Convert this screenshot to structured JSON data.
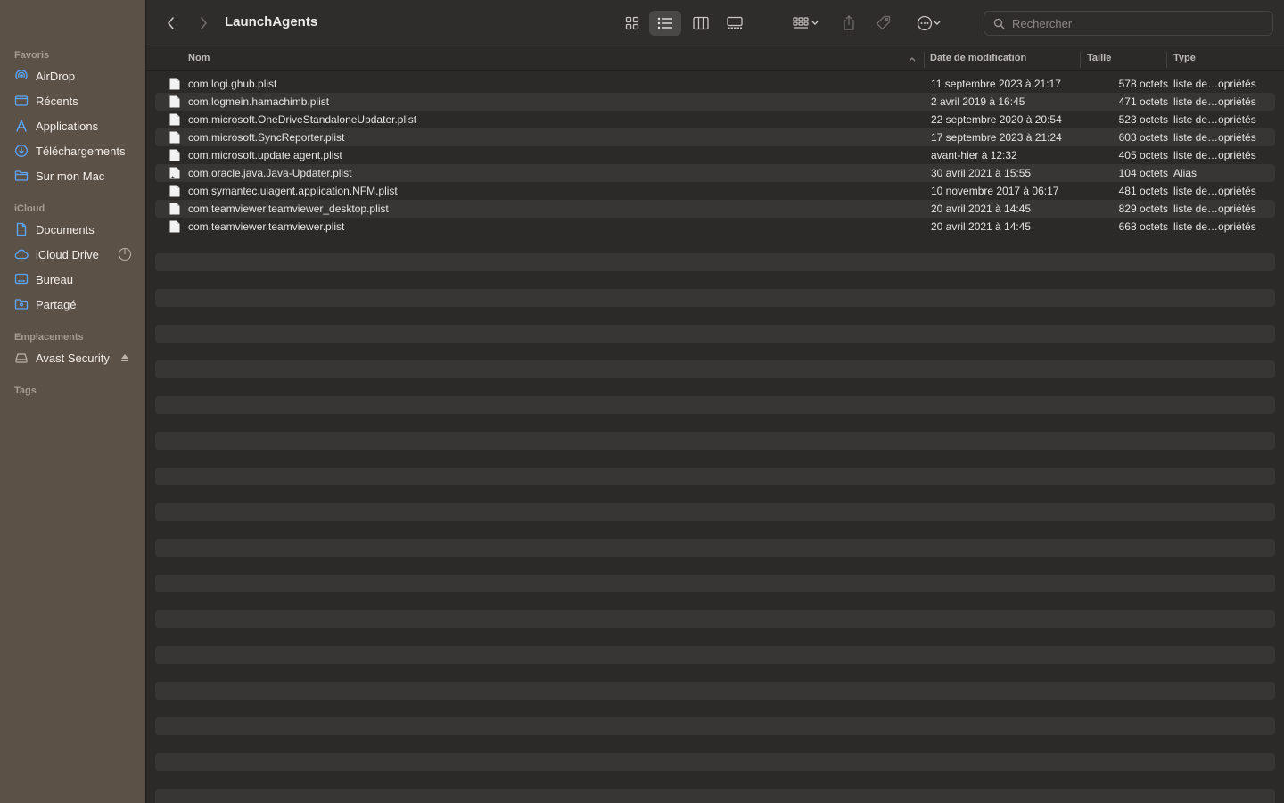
{
  "sidebar": {
    "sections": [
      {
        "title": "Favoris"
      },
      {
        "title": "iCloud"
      },
      {
        "title": "Emplacements"
      },
      {
        "title": "Tags"
      }
    ],
    "favorites": [
      {
        "label": "AirDrop",
        "icon": "airdrop-icon"
      },
      {
        "label": "Récents",
        "icon": "clock-folder-icon"
      },
      {
        "label": "Applications",
        "icon": "applications-icon"
      },
      {
        "label": "Téléchargements",
        "icon": "download-icon"
      },
      {
        "label": "Sur mon Mac",
        "icon": "folder-icon"
      }
    ],
    "icloud": [
      {
        "label": "Documents",
        "icon": "document-icon"
      },
      {
        "label": "iCloud Drive",
        "icon": "cloud-icon"
      },
      {
        "label": "Bureau",
        "icon": "desktop-icon"
      },
      {
        "label": "Partagé",
        "icon": "shared-folder-icon"
      }
    ],
    "locations": [
      {
        "label": "Avast Security",
        "icon": "drive-icon"
      }
    ]
  },
  "toolbar": {
    "title": "LaunchAgents",
    "search_placeholder": "Rechercher"
  },
  "columns": {
    "name": "Nom",
    "date": "Date de modification",
    "size": "Taille",
    "type": "Type"
  },
  "files": [
    {
      "name": "com.logi.ghub.plist",
      "date": "11 septembre 2023 à 21:17",
      "size": "578 octets",
      "type": "liste de…opriétés",
      "alias": false
    },
    {
      "name": "com.logmein.hamachimb.plist",
      "date": "2 avril 2019 à 16:45",
      "size": "471 octets",
      "type": "liste de…opriétés",
      "alias": false
    },
    {
      "name": "com.microsoft.OneDriveStandaloneUpdater.plist",
      "date": "22 septembre 2020 à 20:54",
      "size": "523 octets",
      "type": "liste de…opriétés",
      "alias": false
    },
    {
      "name": "com.microsoft.SyncReporter.plist",
      "date": "17 septembre 2023 à 21:24",
      "size": "603 octets",
      "type": "liste de…opriétés",
      "alias": false
    },
    {
      "name": "com.microsoft.update.agent.plist",
      "date": "avant-hier à 12:32",
      "size": "405 octets",
      "type": "liste de…opriétés",
      "alias": false
    },
    {
      "name": "com.oracle.java.Java-Updater.plist",
      "date": "30 avril 2021 à 15:55",
      "size": "104 octets",
      "type": "Alias",
      "alias": true
    },
    {
      "name": "com.symantec.uiagent.application.NFM.plist",
      "date": "10 novembre 2017 à 06:17",
      "size": "481 octets",
      "type": "liste de…opriétés",
      "alias": false
    },
    {
      "name": "com.teamviewer.teamviewer_desktop.plist",
      "date": "20 avril 2021 à 14:45",
      "size": "829 octets",
      "type": "liste de…opriétés",
      "alias": false
    },
    {
      "name": "com.teamviewer.teamviewer.plist",
      "date": "20 avril 2021 à 14:45",
      "size": "668 octets",
      "type": "liste de…opriétés",
      "alias": false
    }
  ]
}
